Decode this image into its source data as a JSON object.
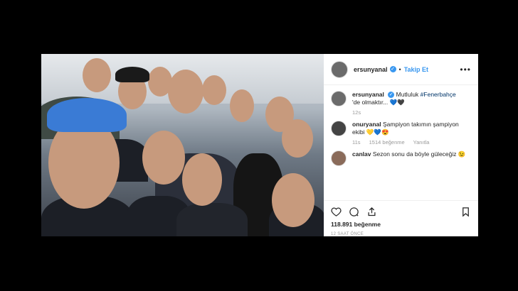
{
  "header": {
    "username": "ersunyanal",
    "dot": "•",
    "follow_label": "Takip Et",
    "more": "•••"
  },
  "caption": {
    "username": "ersunyanal",
    "text": "Mutluluk",
    "hashtag": "#Fenerbahçe",
    "text2": "'de olmaktır... 💙🖤",
    "time": "12s"
  },
  "comments": [
    {
      "username": "onuryanal",
      "text": "Şampiyon takımın şampiyon ekibi 💛💙😍",
      "time": "11s",
      "likes": "1514 beğenme",
      "reply": "Yanıtla"
    },
    {
      "username": "canlav",
      "text": "Sezon sonu da böyle güleceğiz 😉"
    }
  ],
  "actions": {
    "likes": "118.891 beğenme",
    "timestamp": "12 SAAT ÖNCE"
  },
  "colors": {
    "link": "#3897f0",
    "hashtag": "#003569",
    "muted": "#999999"
  }
}
